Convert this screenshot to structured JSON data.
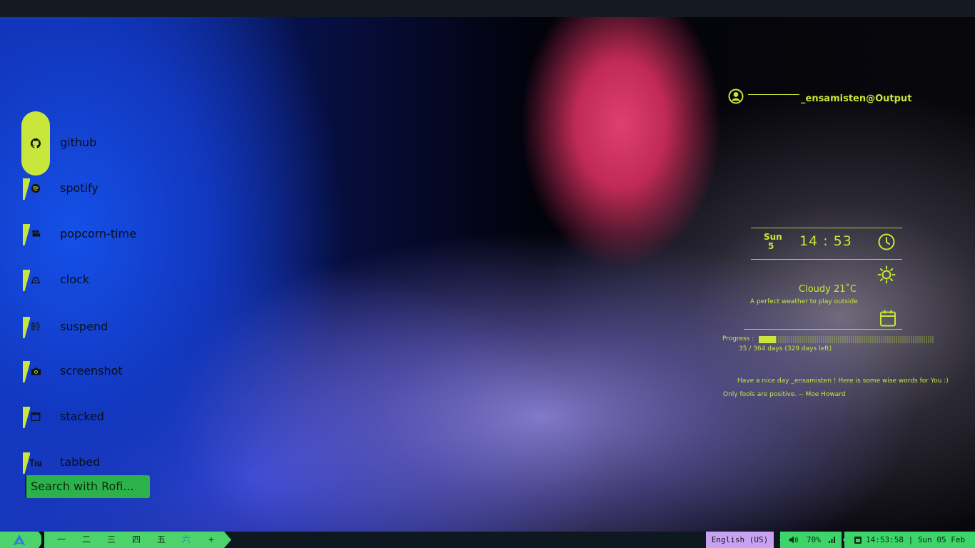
{
  "rofi": {
    "items": [
      {
        "label": "github",
        "icon": "github-icon"
      },
      {
        "label": "spotify",
        "icon": "spotify-icon"
      },
      {
        "label": "popcorn-time",
        "icon": "movie-camera-icon"
      },
      {
        "label": "clock",
        "icon": "alarm-clock-icon"
      },
      {
        "label": "suspend",
        "icon": "suspend-icon"
      },
      {
        "label": "screenshot",
        "icon": "camera-icon"
      },
      {
        "label": "stacked",
        "icon": "window-stacked-icon"
      },
      {
        "label": "tabbed",
        "icon": "tabbed-icon"
      }
    ],
    "selected_index": 0,
    "search_placeholder": "Search with Rofi..."
  },
  "conky": {
    "user": "_ensamisten@Output",
    "day_name": "Sun",
    "day_num": "5",
    "time": "14 : 53",
    "weather": "Cloudy 21˚C",
    "weather_sub": "A perfect weather to play outside",
    "progress_label": "Progress :",
    "progress_fraction": 0.096,
    "progress_days": "35 / 364 days (329 days left)",
    "greeting": "Have a nice day _ensamisten ! Here is some wise words for You :)",
    "quote": "Only fools are positive.  -- Moe Howard"
  },
  "taskbar": {
    "workspaces": [
      "一",
      "二",
      "三",
      "四",
      "五",
      "六",
      "+"
    ],
    "active_workspace": 5,
    "language": "English (US)",
    "volume": "70%",
    "datetime": "14:53:58 | Sun 05 Feb"
  },
  "colors": {
    "accent": "#c8e63c",
    "bar_green": "#4dd36b",
    "lang_purple": "#c9a3f0"
  }
}
